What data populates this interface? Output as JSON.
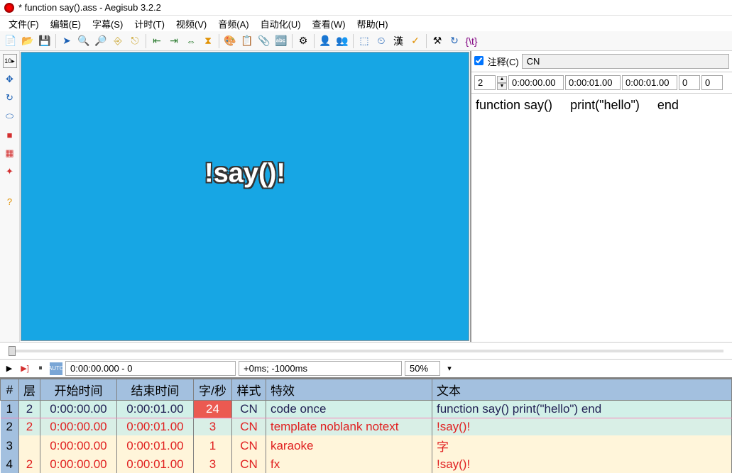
{
  "title": "* function say().ass - Aegisub 3.2.2",
  "menu": {
    "file": "文件(F)",
    "edit": "编辑(E)",
    "subtitle": "字幕(S)",
    "timing": "计时(T)",
    "video": "视频(V)",
    "audio": "音频(A)",
    "automation": "自动化(U)",
    "view": "查看(W)",
    "help": "帮助(H)"
  },
  "preview_text": "!say()!",
  "edit": {
    "comment_label": "注释(C)",
    "comment_checked": true,
    "style": "CN",
    "layer": "2",
    "start": "0:00:00.00",
    "end": "0:00:01.00",
    "dur": "0:00:01.00",
    "m1": "0",
    "m2": "0",
    "text_parts": {
      "a": "function say()",
      "b": "print(\"hello\")",
      "c": "end"
    }
  },
  "controls": {
    "pos": "0:00:00.000 - 0",
    "offset": "+0ms; -1000ms",
    "zoom": "50%"
  },
  "grid": {
    "headers": {
      "num": "#",
      "layer": "层",
      "start": "开始时间",
      "end": "结束时间",
      "cps": "字/秒",
      "style": "样式",
      "effect": "特效",
      "text": "文本"
    },
    "rows": [
      {
        "n": "1",
        "layer": "2",
        "start": "0:00:00.00",
        "end": "0:00:01.00",
        "cps": "24",
        "style": "CN",
        "effect": "code once",
        "text": "function say()    print(\"hello\")    end",
        "cls": "r1"
      },
      {
        "n": "2",
        "layer": "2",
        "start": "0:00:00.00",
        "end": "0:00:01.00",
        "cps": "3",
        "style": "CN",
        "effect": "template noblank notext",
        "text": "!say()!",
        "cls": "rcom"
      },
      {
        "n": "3",
        "layer": "",
        "start": "0:00:00.00",
        "end": "0:00:01.00",
        "cps": "1",
        "style": "CN",
        "effect": "karaoke",
        "text": "字",
        "cls": "r3"
      },
      {
        "n": "4",
        "layer": "2",
        "start": "0:00:00.00",
        "end": "0:00:01.00",
        "cps": "3",
        "style": "CN",
        "effect": "fx",
        "text": "!say()!",
        "cls": "r4"
      }
    ]
  }
}
